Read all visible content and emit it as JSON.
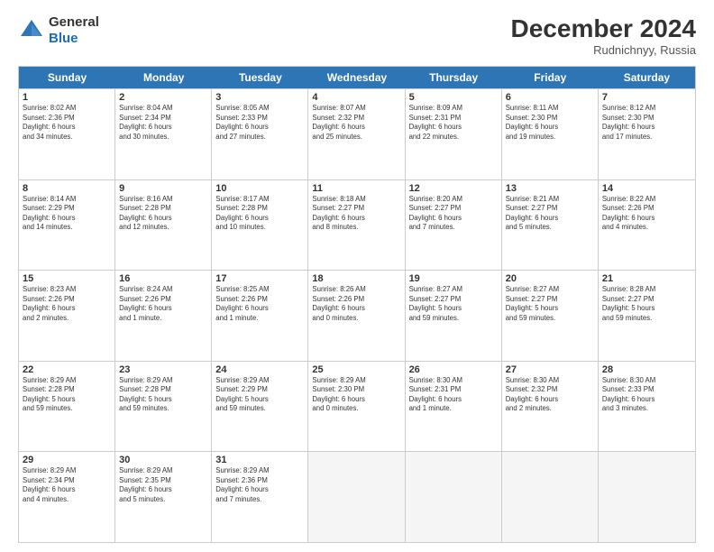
{
  "header": {
    "logo_general": "General",
    "logo_blue": "Blue",
    "month_title": "December 2024",
    "location": "Rudnichnyy, Russia"
  },
  "weekdays": [
    "Sunday",
    "Monday",
    "Tuesday",
    "Wednesday",
    "Thursday",
    "Friday",
    "Saturday"
  ],
  "rows": [
    [
      {
        "day": "1",
        "info": "Sunrise: 8:02 AM\nSunset: 2:36 PM\nDaylight: 6 hours\nand 34 minutes."
      },
      {
        "day": "2",
        "info": "Sunrise: 8:04 AM\nSunset: 2:34 PM\nDaylight: 6 hours\nand 30 minutes."
      },
      {
        "day": "3",
        "info": "Sunrise: 8:05 AM\nSunset: 2:33 PM\nDaylight: 6 hours\nand 27 minutes."
      },
      {
        "day": "4",
        "info": "Sunrise: 8:07 AM\nSunset: 2:32 PM\nDaylight: 6 hours\nand 25 minutes."
      },
      {
        "day": "5",
        "info": "Sunrise: 8:09 AM\nSunset: 2:31 PM\nDaylight: 6 hours\nand 22 minutes."
      },
      {
        "day": "6",
        "info": "Sunrise: 8:11 AM\nSunset: 2:30 PM\nDaylight: 6 hours\nand 19 minutes."
      },
      {
        "day": "7",
        "info": "Sunrise: 8:12 AM\nSunset: 2:30 PM\nDaylight: 6 hours\nand 17 minutes."
      }
    ],
    [
      {
        "day": "8",
        "info": "Sunrise: 8:14 AM\nSunset: 2:29 PM\nDaylight: 6 hours\nand 14 minutes."
      },
      {
        "day": "9",
        "info": "Sunrise: 8:16 AM\nSunset: 2:28 PM\nDaylight: 6 hours\nand 12 minutes."
      },
      {
        "day": "10",
        "info": "Sunrise: 8:17 AM\nSunset: 2:28 PM\nDaylight: 6 hours\nand 10 minutes."
      },
      {
        "day": "11",
        "info": "Sunrise: 8:18 AM\nSunset: 2:27 PM\nDaylight: 6 hours\nand 8 minutes."
      },
      {
        "day": "12",
        "info": "Sunrise: 8:20 AM\nSunset: 2:27 PM\nDaylight: 6 hours\nand 7 minutes."
      },
      {
        "day": "13",
        "info": "Sunrise: 8:21 AM\nSunset: 2:27 PM\nDaylight: 6 hours\nand 5 minutes."
      },
      {
        "day": "14",
        "info": "Sunrise: 8:22 AM\nSunset: 2:26 PM\nDaylight: 6 hours\nand 4 minutes."
      }
    ],
    [
      {
        "day": "15",
        "info": "Sunrise: 8:23 AM\nSunset: 2:26 PM\nDaylight: 6 hours\nand 2 minutes."
      },
      {
        "day": "16",
        "info": "Sunrise: 8:24 AM\nSunset: 2:26 PM\nDaylight: 6 hours\nand 1 minute."
      },
      {
        "day": "17",
        "info": "Sunrise: 8:25 AM\nSunset: 2:26 PM\nDaylight: 6 hours\nand 1 minute."
      },
      {
        "day": "18",
        "info": "Sunrise: 8:26 AM\nSunset: 2:26 PM\nDaylight: 6 hours\nand 0 minutes."
      },
      {
        "day": "19",
        "info": "Sunrise: 8:27 AM\nSunset: 2:27 PM\nDaylight: 5 hours\nand 59 minutes."
      },
      {
        "day": "20",
        "info": "Sunrise: 8:27 AM\nSunset: 2:27 PM\nDaylight: 5 hours\nand 59 minutes."
      },
      {
        "day": "21",
        "info": "Sunrise: 8:28 AM\nSunset: 2:27 PM\nDaylight: 5 hours\nand 59 minutes."
      }
    ],
    [
      {
        "day": "22",
        "info": "Sunrise: 8:29 AM\nSunset: 2:28 PM\nDaylight: 5 hours\nand 59 minutes."
      },
      {
        "day": "23",
        "info": "Sunrise: 8:29 AM\nSunset: 2:28 PM\nDaylight: 5 hours\nand 59 minutes."
      },
      {
        "day": "24",
        "info": "Sunrise: 8:29 AM\nSunset: 2:29 PM\nDaylight: 5 hours\nand 59 minutes."
      },
      {
        "day": "25",
        "info": "Sunrise: 8:29 AM\nSunset: 2:30 PM\nDaylight: 6 hours\nand 0 minutes."
      },
      {
        "day": "26",
        "info": "Sunrise: 8:30 AM\nSunset: 2:31 PM\nDaylight: 6 hours\nand 1 minute."
      },
      {
        "day": "27",
        "info": "Sunrise: 8:30 AM\nSunset: 2:32 PM\nDaylight: 6 hours\nand 2 minutes."
      },
      {
        "day": "28",
        "info": "Sunrise: 8:30 AM\nSunset: 2:33 PM\nDaylight: 6 hours\nand 3 minutes."
      }
    ],
    [
      {
        "day": "29",
        "info": "Sunrise: 8:29 AM\nSunset: 2:34 PM\nDaylight: 6 hours\nand 4 minutes."
      },
      {
        "day": "30",
        "info": "Sunrise: 8:29 AM\nSunset: 2:35 PM\nDaylight: 6 hours\nand 5 minutes."
      },
      {
        "day": "31",
        "info": "Sunrise: 8:29 AM\nSunset: 2:36 PM\nDaylight: 6 hours\nand 7 minutes."
      },
      null,
      null,
      null,
      null
    ]
  ]
}
